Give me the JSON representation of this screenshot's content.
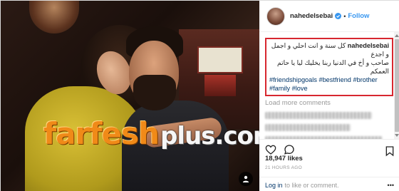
{
  "post": {
    "watermark": {
      "main": "farfesh",
      "sub": "plus.com"
    },
    "header": {
      "username": "nahedelsebai",
      "separator": "•",
      "follow_label": "Follow"
    },
    "caption": {
      "username": "nahedelsebai",
      "arabic_line_1": "كل سنة و انت احلي و اجمل و اجدع",
      "arabic_line_2": "صاحب و أخ في الدنيا ربنا يخليك ليا يا حاتم العمكم",
      "hashtags_line_1": "#friendshipgoals #bestfriend #brother",
      "hashtags_line_2": "#family #love"
    },
    "load_more_label": "Load more comments",
    "likes": "18,947 likes",
    "timestamp": "21 HOURS AGO",
    "login": {
      "link": "Log in",
      "rest": "to like or comment."
    },
    "more_label": "•••",
    "colors": {
      "accent": "#3897f0",
      "highlight_border": "#d7272f",
      "hashtag": "#003569"
    },
    "icons": [
      "heart-icon",
      "comment-icon",
      "bookmark-icon",
      "verified-icon",
      "user-tag-icon"
    ]
  }
}
